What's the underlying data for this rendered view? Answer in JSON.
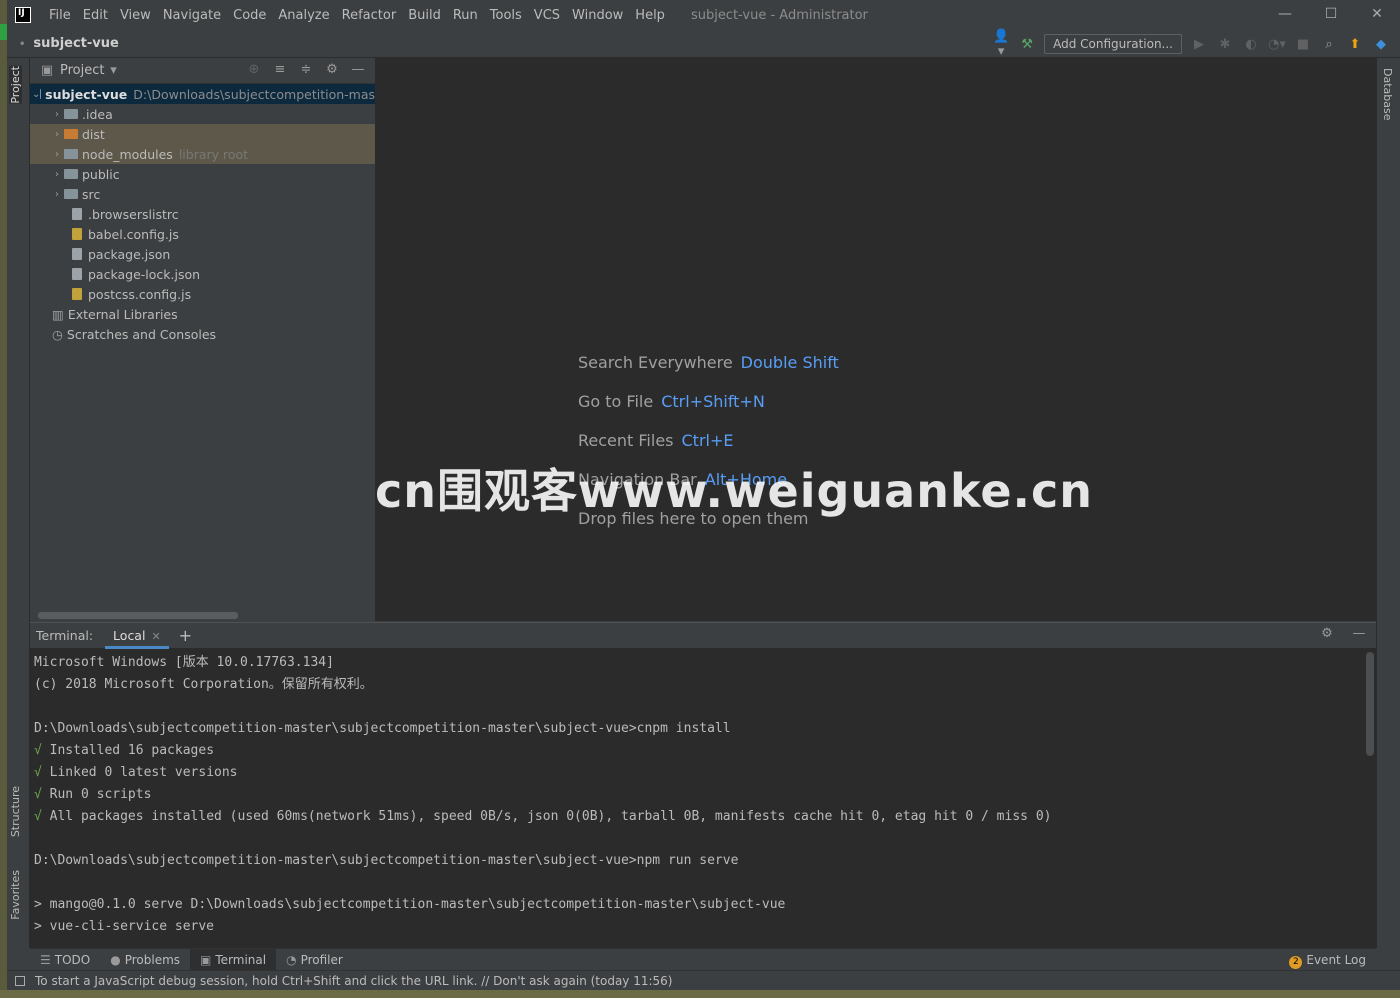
{
  "window": {
    "title": "subject-vue - Administrator",
    "minimize": "—",
    "maximize": "☐",
    "close": "✕"
  },
  "menu": [
    "File",
    "Edit",
    "View",
    "Navigate",
    "Code",
    "Analyze",
    "Refactor",
    "Build",
    "Run",
    "Tools",
    "VCS",
    "Window",
    "Help"
  ],
  "navbar": {
    "breadcrumb": "subject-vue",
    "add_configuration": "Add Configuration..."
  },
  "left_strip": {
    "project_tab": "Project",
    "structure_tab": "Structure",
    "favorites_tab": "Favorites"
  },
  "right_strip": {
    "database_tab": "Database"
  },
  "project_panel": {
    "title": "Project",
    "root_name": "subject-vue",
    "root_path": "D:\\Downloads\\subjectcompetition-mas",
    "items": [
      {
        "label": ".idea",
        "type": "folder"
      },
      {
        "label": "dist",
        "type": "folder-orange"
      },
      {
        "label": "node_modules",
        "type": "folder",
        "hint": "library root"
      },
      {
        "label": "public",
        "type": "folder"
      },
      {
        "label": "src",
        "type": "folder"
      },
      {
        "label": ".browserslistrc",
        "type": "file"
      },
      {
        "label": "babel.config.js",
        "type": "js"
      },
      {
        "label": "package.json",
        "type": "file"
      },
      {
        "label": "package-lock.json",
        "type": "file"
      },
      {
        "label": "postcss.config.js",
        "type": "js"
      }
    ],
    "external_libraries": "External Libraries",
    "scratches": "Scratches and Consoles"
  },
  "editor": {
    "tips": [
      {
        "label": "Search Everywhere",
        "shortcut": "Double Shift"
      },
      {
        "label": "Go to File",
        "shortcut": "Ctrl+Shift+N"
      },
      {
        "label": "Recent Files",
        "shortcut": "Ctrl+E"
      },
      {
        "label": "Navigation Bar",
        "shortcut": "Alt+Home"
      },
      {
        "label": "Drop files here to open them",
        "shortcut": ""
      }
    ]
  },
  "watermark": "cn围观客www.weiguanke.cn",
  "terminal": {
    "label": "Terminal:",
    "tab": "Local",
    "lines": [
      {
        "text": "Microsoft Windows [版本 10.0.17763.134]",
        "ok": false
      },
      {
        "text": "(c) 2018 Microsoft Corporation。保留所有权利。",
        "ok": false
      },
      {
        "text": "",
        "ok": false
      },
      {
        "text": "D:\\Downloads\\subjectcompetition-master\\subjectcompetition-master\\subject-vue>cnpm install",
        "ok": false
      },
      {
        "text": "Installed 16 packages",
        "ok": true
      },
      {
        "text": "Linked 0 latest versions",
        "ok": true
      },
      {
        "text": "Run 0 scripts",
        "ok": true
      },
      {
        "text": "All packages installed (used 60ms(network 51ms), speed 0B/s, json 0(0B), tarball 0B, manifests cache hit 0, etag hit 0 / miss 0)",
        "ok": true
      },
      {
        "text": "",
        "ok": false
      },
      {
        "text": "D:\\Downloads\\subjectcompetition-master\\subjectcompetition-master\\subject-vue>npm run serve",
        "ok": false
      },
      {
        "text": "",
        "ok": false
      },
      {
        "text": "> mango@0.1.0 serve D:\\Downloads\\subjectcompetition-master\\subjectcompetition-master\\subject-vue",
        "ok": false
      },
      {
        "text": "> vue-cli-service serve",
        "ok": false
      }
    ]
  },
  "bottom_tabs": {
    "todo": "TODO",
    "problems": "Problems",
    "terminal": "Terminal",
    "profiler": "Profiler",
    "event_log": "Event Log",
    "event_count": "2"
  },
  "status": {
    "message": "To start a JavaScript debug session, hold Ctrl+Shift and click the URL link. // Don't ask again (today 11:56)"
  }
}
